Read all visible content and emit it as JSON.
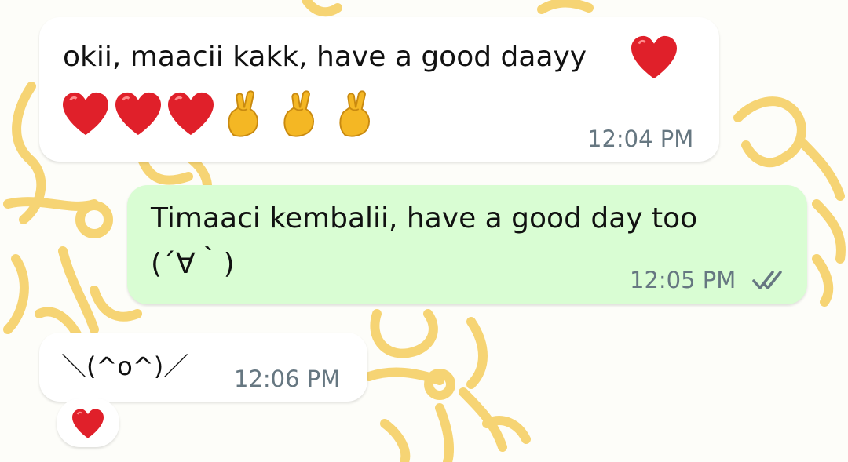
{
  "messages": [
    {
      "direction": "incoming",
      "text": "okii, maacii kakk, have a good daayy",
      "emoji_line": [
        "red-heart",
        "red-heart",
        "red-heart",
        "crossed-fingers",
        "crossed-fingers",
        "crossed-fingers"
      ],
      "time": "12:04 PM"
    },
    {
      "direction": "outgoing",
      "text_line1": "Timaaci kembalii, have a good day too",
      "text_line2": "(´∀｀)",
      "time": "12:05 PM",
      "status_icon": "double-check-read-icon"
    },
    {
      "direction": "incoming",
      "text": "＼(^o^)／",
      "time": "12:06 PM",
      "reaction": "red-heart"
    }
  ],
  "colors": {
    "incoming_bubble": "#ffffff",
    "outgoing_bubble": "#d9fdd3",
    "wallpaper_doodle": "#f6d474",
    "timestamp": "#667781",
    "heart": "#e0202a"
  }
}
